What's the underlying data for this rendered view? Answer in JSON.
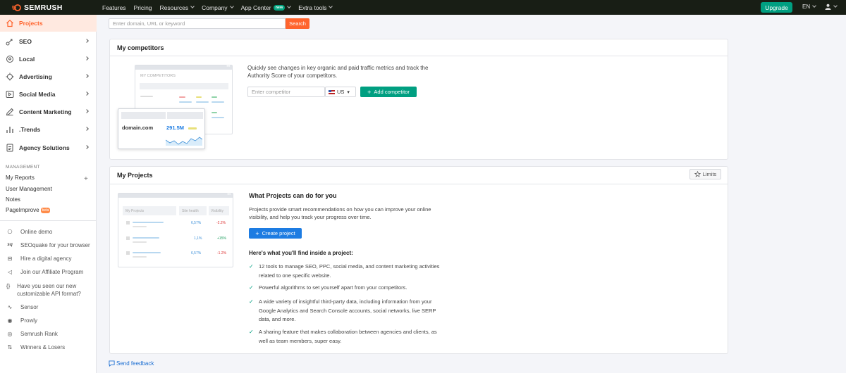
{
  "topnav": {
    "logo": "SEMRUSH",
    "items": [
      {
        "label": "Features"
      },
      {
        "label": "Pricing"
      },
      {
        "label": "Resources"
      },
      {
        "label": "Company"
      },
      {
        "label": "App Center",
        "badge": "new"
      },
      {
        "label": "Extra tools"
      }
    ],
    "upgrade": "Upgrade",
    "language": "EN"
  },
  "sidebar": {
    "active": "Projects",
    "items": [
      {
        "label": "SEO",
        "icon": "seo-icon"
      },
      {
        "label": "Local",
        "icon": "location-pin-icon"
      },
      {
        "label": "Advertising",
        "icon": "target-icon"
      },
      {
        "label": "Social Media",
        "icon": "social-media-icon"
      },
      {
        "label": "Content Marketing",
        "icon": "pencil-icon"
      },
      {
        "label": ".Trends",
        "icon": "trends-bars-icon"
      },
      {
        "label": "Agency Solutions",
        "icon": "document-icon"
      }
    ],
    "management_heading": "MANAGEMENT",
    "management": [
      "My Reports",
      "User Management",
      "Notes",
      "PageImprove"
    ],
    "pageimprove_badge": "beta",
    "extras": [
      {
        "label": "Online demo",
        "icon": "demo-icon"
      },
      {
        "label": "SEOquake for your browser",
        "icon": "seoquake-icon"
      },
      {
        "label": "Hire a digital agency",
        "icon": "agency-icon"
      },
      {
        "label": "Join our Affiliate Program",
        "icon": "megaphone-icon"
      },
      {
        "label": "Have you seen our new customizable API format?",
        "icon": "api-braces-icon"
      },
      {
        "label": "Sensor",
        "icon": "sensor-icon"
      },
      {
        "label": "Prowly",
        "icon": "prowly-icon"
      },
      {
        "label": "Semrush Rank",
        "icon": "rank-icon"
      },
      {
        "label": "Winners & Losers",
        "icon": "winners-losers-icon"
      }
    ]
  },
  "search": {
    "placeholder": "Enter domain, URL or keyword",
    "button": "Search"
  },
  "competitors": {
    "title": "My competitors",
    "description": "Quickly see changes in key organic and paid traffic metrics and track the Authority Score of your competitors.",
    "input_placeholder": "Enter competitor",
    "country": "US",
    "add_button": "Add competitor",
    "illustration": {
      "window_title": "MY COMPETITORS",
      "domain": "domain.com",
      "value": "291.5M"
    }
  },
  "projects": {
    "title": "My Projects",
    "limits": "Limits",
    "heading": "What Projects can do for you",
    "description": "Projects provide smart recommendations on how you can improve your online visibility, and help you track your progress over time.",
    "create_button": "Create project",
    "inside_heading": "Here's what you'll find inside a project:",
    "features": [
      "12 tools to manage SEO, PPC, social media, and content marketing activities related to one specific website.",
      "Powerful algorithms to set yourself apart from your competitors.",
      "A wide variety of insightful third-party data, including information from your Google Analytics and Search Console accounts, social networks, live SERP data, and more.",
      "A sharing feature that makes collaboration between agencies and clients, as well as team members, super easy."
    ],
    "illustration": {
      "headers": [
        "My Projects",
        "Site health",
        "Visibility"
      ],
      "rows": [
        {
          "health": "6,57%",
          "visibility": "-2.2%"
        },
        {
          "health": "1,1%",
          "visibility": "+15%"
        },
        {
          "health": "6,57%",
          "visibility": "-1.2%"
        }
      ]
    }
  },
  "feedback": "Send feedback",
  "colors": {
    "brand": "#ff642d",
    "green": "#009f81",
    "blue": "#1d7ce2"
  }
}
